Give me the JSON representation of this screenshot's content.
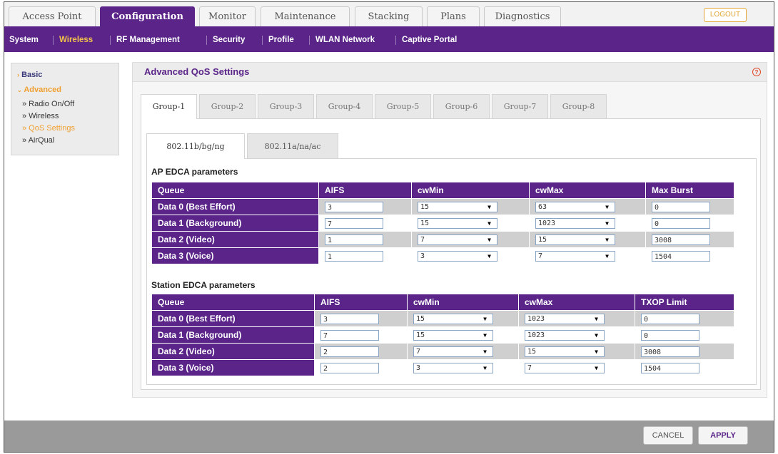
{
  "top_tabs": [
    "Access Point",
    "Configuration",
    "Monitor",
    "Maintenance",
    "Stacking",
    "Plans",
    "Diagnostics"
  ],
  "logout_label": "LOGOUT",
  "sub_nav": [
    "System",
    "Wireless",
    "RF Management",
    "Security",
    "Profile",
    "WLAN Network",
    "Captive Portal"
  ],
  "sidebar": {
    "basic": "Basic",
    "advanced": "Advanced",
    "items": [
      "» Radio On/Off",
      "» Wireless",
      "» QoS Settings",
      "» AirQual"
    ]
  },
  "panel": {
    "title": "Advanced QoS Settings",
    "help_icon": "?"
  },
  "group_tabs": [
    "Group-1",
    "Group-2",
    "Group-3",
    "Group-4",
    "Group-5",
    "Group-6",
    "Group-7",
    "Group-8"
  ],
  "band_tabs": [
    "802.11b/bg/ng",
    "802.11a/na/ac"
  ],
  "ap_edca": {
    "title": "AP EDCA parameters",
    "headers": [
      "Queue",
      "AIFS",
      "cwMin",
      "cwMax",
      "Max Burst"
    ],
    "rows": [
      {
        "queue": "Data 0 (Best Effort)",
        "aifs": "3",
        "cwmin": "15",
        "cwmax": "63",
        "last": "0"
      },
      {
        "queue": "Data 1 (Background)",
        "aifs": "7",
        "cwmin": "15",
        "cwmax": "1023",
        "last": "0"
      },
      {
        "queue": "Data 2 (Video)",
        "aifs": "1",
        "cwmin": "7",
        "cwmax": "15",
        "last": "3008"
      },
      {
        "queue": "Data 3 (Voice)",
        "aifs": "1",
        "cwmin": "3",
        "cwmax": "7",
        "last": "1504"
      }
    ]
  },
  "station_edca": {
    "title": "Station EDCA parameters",
    "headers": [
      "Queue",
      "AIFS",
      "cwMin",
      "cwMax",
      "TXOP Limit"
    ],
    "rows": [
      {
        "queue": "Data 0 (Best Effort)",
        "aifs": "3",
        "cwmin": "15",
        "cwmax": "1023",
        "last": "0"
      },
      {
        "queue": "Data 1 (Background)",
        "aifs": "7",
        "cwmin": "15",
        "cwmax": "1023",
        "last": "0"
      },
      {
        "queue": "Data 2 (Video)",
        "aifs": "2",
        "cwmin": "7",
        "cwmax": "15",
        "last": "3008"
      },
      {
        "queue": "Data 3 (Voice)",
        "aifs": "2",
        "cwmin": "3",
        "cwmax": "7",
        "last": "1504"
      }
    ]
  },
  "buttons": {
    "cancel": "CANCEL",
    "apply": "APPLY"
  },
  "colors": {
    "brand_purple": "#5a2489",
    "active_orange": "#f0a030",
    "logout_orange": "#e2a83a"
  }
}
